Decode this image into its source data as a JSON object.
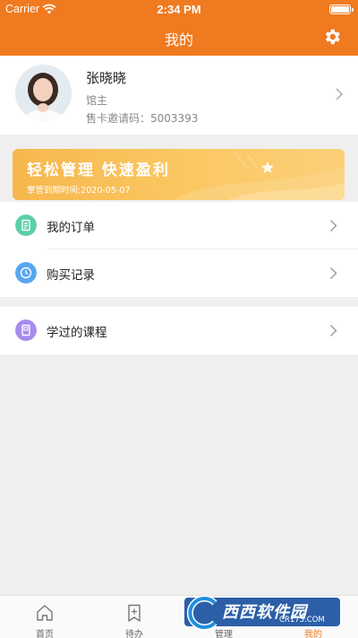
{
  "status_bar": {
    "carrier": "Carrier",
    "time": "2:34 PM"
  },
  "header": {
    "title": "我的",
    "settings_icon": "gear-icon"
  },
  "profile": {
    "name": "张晓晓",
    "role": "馆主",
    "invite_code": "售卡邀请码：5003393"
  },
  "banner": {
    "title": "轻松管理 快速盈利",
    "subtitle": "掌管到期时间:2020-05-07"
  },
  "menu_group_1": [
    {
      "label": "我的订单",
      "icon": "document-icon",
      "color": "#5ccfa9"
    },
    {
      "label": "购买记录",
      "icon": "clock-icon",
      "color": "#5aa6f0"
    }
  ],
  "menu_group_2": [
    {
      "label": "学过的课程",
      "icon": "book-icon",
      "color": "#a78bf0"
    }
  ],
  "tabbar": {
    "tabs": [
      {
        "label": "首页",
        "icon": "home-icon"
      },
      {
        "label": "待办",
        "icon": "bookmark-plus-icon"
      },
      {
        "label": "管理",
        "icon": "grid-icon"
      },
      {
        "label": "我的",
        "icon": "user-icon",
        "active": true
      }
    ]
  },
  "watermark": {
    "text": "西西软件园",
    "url": "CR173.COM"
  },
  "colors": {
    "accent": "#f07a1f",
    "background": "#efefef"
  }
}
